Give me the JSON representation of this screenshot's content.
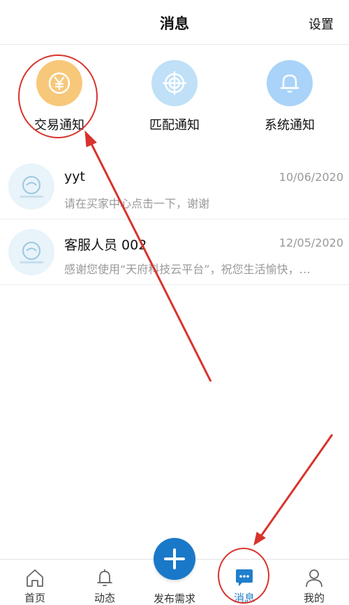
{
  "header": {
    "title": "消息",
    "settings_label": "设置"
  },
  "categories": [
    {
      "label": "交易通知",
      "icon": "yen-coin-icon",
      "color": "#f7c87a"
    },
    {
      "label": "匹配通知",
      "icon": "target-icon",
      "color": "#bfe0f7"
    },
    {
      "label": "系统通知",
      "icon": "bell-icon",
      "color": "#a9d3f8"
    }
  ],
  "messages": [
    {
      "name": "yyt",
      "date": "10/06/2020",
      "preview": "请在买家中心点击一下，谢谢"
    },
    {
      "name": "客服人员 002",
      "date": "12/05/2020",
      "preview": "感谢您使用“天府科技云平台”，祝您生活愉快，…"
    }
  ],
  "tabbar": {
    "home": "首页",
    "feed": "动态",
    "publish": "发布需求",
    "messages": "消息",
    "mine": "我的"
  },
  "colors": {
    "accent": "#1a78c8",
    "annotation": "#d8332c"
  }
}
